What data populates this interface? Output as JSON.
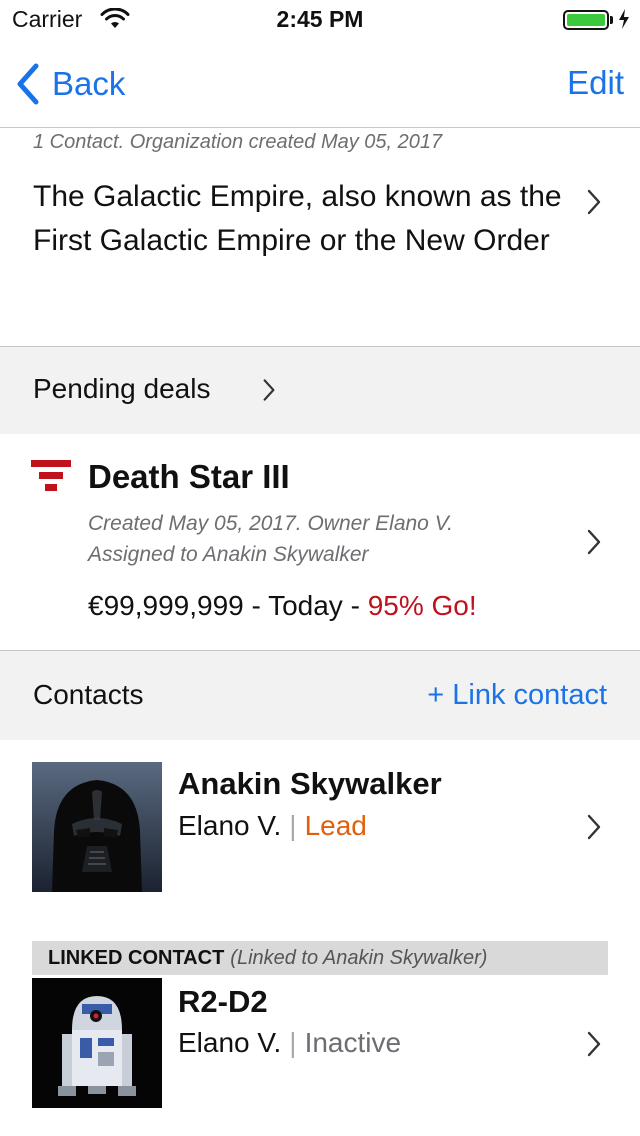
{
  "status_bar": {
    "carrier": "Carrier",
    "time": "2:45 PM",
    "battery_color": "#3cc93c"
  },
  "nav": {
    "back_label": "Back",
    "edit_label": "Edit",
    "accent": "#1a73e8"
  },
  "organization": {
    "meta": "1 Contact. Organization created May 05, 2017",
    "description": "The Galactic Empire, also known as the First Galactic Empire or the New Order"
  },
  "pending_deals": {
    "header": "Pending deals",
    "deal": {
      "icon": "empire-emblem-icon",
      "title": "Death Star III",
      "meta_line1": "Created May 05, 2017. Owner Elano V.",
      "meta_line2": "Assigned to Anakin Skywalker",
      "amount_text": "€99,999,999 - Today - ",
      "probability_text": "95% Go!",
      "probability_color": "#c0121c"
    }
  },
  "contacts": {
    "header": "Contacts",
    "link_label": "+ Link contact",
    "items": [
      {
        "name": "Anakin Skywalker",
        "owner": "Elano V.",
        "separator": "|",
        "stage": "Lead",
        "stage_color": "#e0600d",
        "avatar": "darth-vader-avatar"
      },
      {
        "linked_title": "LINKED CONTACT",
        "linked_sub": "(Linked to Anakin Skywalker)",
        "name": "R2-D2",
        "owner": "Elano V.",
        "separator": "|",
        "stage": "Inactive",
        "stage_color": "#6d6d72",
        "avatar": "r2d2-avatar"
      }
    ]
  }
}
